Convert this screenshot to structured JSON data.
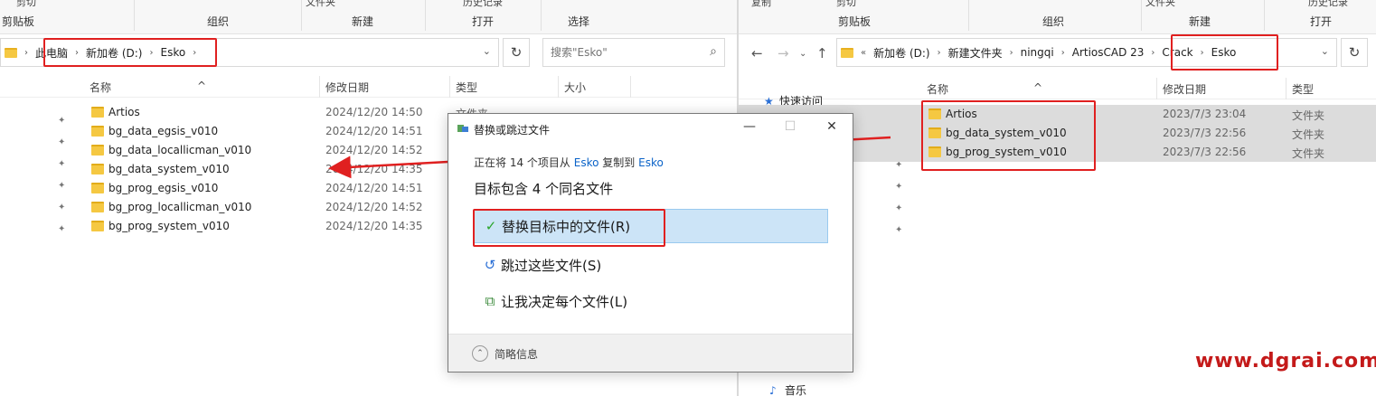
{
  "left": {
    "ribbon": {
      "top_items": [
        "剪切",
        "文件夹",
        "历史记录"
      ],
      "groups": [
        "剪贴板",
        "组织",
        "新建",
        "打开",
        "选择"
      ]
    },
    "breadcrumb": [
      "此电脑",
      "新加卷 (D:)",
      "Esko"
    ],
    "search_placeholder": "搜索\"Esko\"",
    "columns": [
      "名称",
      "修改日期",
      "类型",
      "大小"
    ],
    "partial_type": "文件夹",
    "rows": [
      {
        "name": "Artios",
        "date": "2024/12/20 14:50"
      },
      {
        "name": "bg_data_egsis_v010",
        "date": "2024/12/20 14:51"
      },
      {
        "name": "bg_data_locallicman_v010",
        "date": "2024/12/20 14:52"
      },
      {
        "name": "bg_data_system_v010",
        "date": "2024/12/20 14:35"
      },
      {
        "name": "bg_prog_egsis_v010",
        "date": "2024/12/20 14:51"
      },
      {
        "name": "bg_prog_locallicman_v010",
        "date": "2024/12/20 14:52"
      },
      {
        "name": "bg_prog_system_v010",
        "date": "2024/12/20 14:35"
      }
    ]
  },
  "right": {
    "ribbon": {
      "top_items": [
        "复制",
        "剪切",
        "文件夹",
        "历史记录"
      ],
      "groups": [
        "剪贴板",
        "组织",
        "新建",
        "打开"
      ]
    },
    "breadcrumb": [
      "新加卷 (D:)",
      "新建文件夹",
      "ningqi",
      "ArtiosCAD 23",
      "Crack",
      "Esko"
    ],
    "overflow_marker": "«",
    "columns": [
      "名称",
      "修改日期",
      "类型"
    ],
    "nav": {
      "quick_access": "快速访问",
      "music": "音乐"
    },
    "rows": [
      {
        "name": "Artios",
        "date": "2023/7/3 23:04",
        "type": "文件夹"
      },
      {
        "name": "bg_data_system_v010",
        "date": "2023/7/3 22:56",
        "type": "文件夹"
      },
      {
        "name": "bg_prog_system_v010",
        "date": "2023/7/3 22:56",
        "type": "文件夹"
      }
    ]
  },
  "dialog": {
    "title": "替换或跳过文件",
    "info_prefix": "正在将 14 个项目从",
    "info_source": "Esko",
    "info_mid": "复制到",
    "info_dest": "Esko",
    "headline": "目标包含 4 个同名文件",
    "options": [
      {
        "label": "替换目标中的文件(R)",
        "icon": "checkmark-icon"
      },
      {
        "label": "跳过这些文件(S)",
        "icon": "skip-arrow-icon"
      },
      {
        "label": "让我决定每个文件(L)",
        "icon": "compare-files-icon"
      }
    ],
    "footer": "简略信息"
  },
  "watermark": "www.dgrai.com",
  "colors": {
    "highlight": "#e02020",
    "accent_link": "#0b63c8",
    "option_highlight": "#cce4f7",
    "watermark": "#c41a1a"
  }
}
